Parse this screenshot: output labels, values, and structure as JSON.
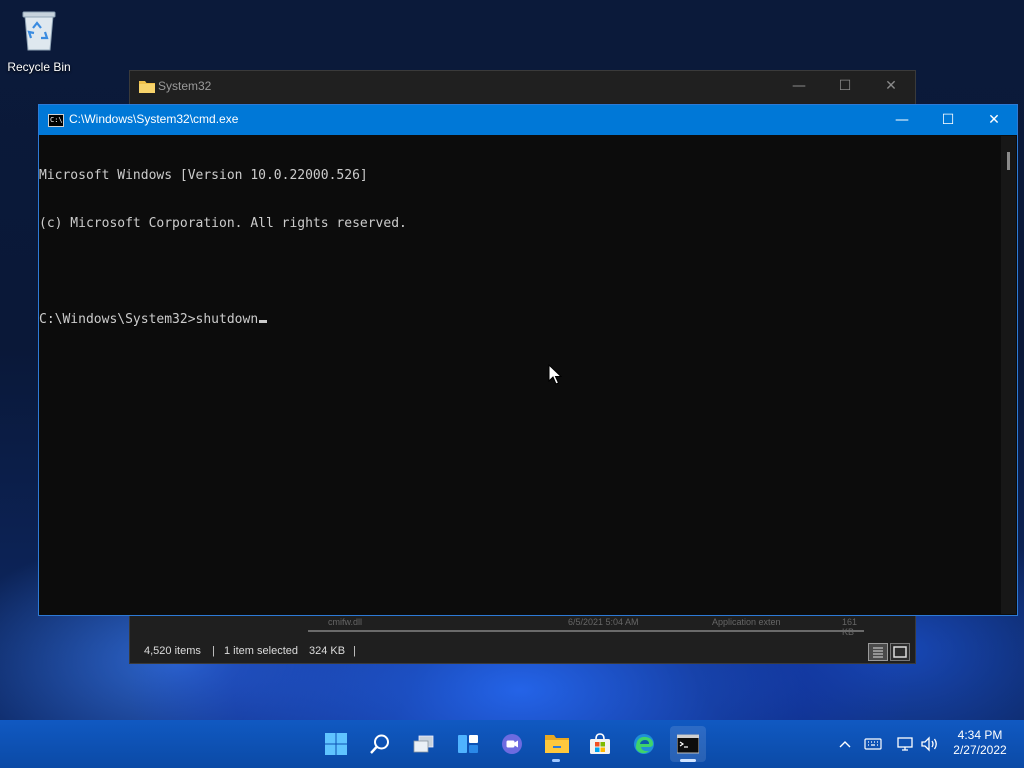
{
  "desktop": {
    "icons": [
      {
        "label": "Recycle Bin",
        "icon": "recycle-bin-icon"
      }
    ]
  },
  "explorer": {
    "title": "System32",
    "status": {
      "items_count": "4,520 items",
      "selected": "1 item selected",
      "size": "324 KB",
      "separator": "|"
    },
    "ghost_row": {
      "name": "cmifw.dll",
      "date": "6/5/2021 5:04 AM",
      "type": "Application exten",
      "size": "161 KB"
    }
  },
  "cmd": {
    "title": "C:\\Windows\\System32\\cmd.exe",
    "icon_glyph": "C:\\",
    "lines": [
      "Microsoft Windows [Version 10.0.22000.526]",
      "(c) Microsoft Corporation. All rights reserved.",
      "",
      "C:\\Windows\\System32>shutdown"
    ]
  },
  "window_controls": {
    "minimize": "—",
    "maximize": "☐",
    "close": "✕"
  },
  "taskbar": {
    "items": [
      {
        "name": "start-button",
        "icon": "windows-logo-icon"
      },
      {
        "name": "search-button",
        "icon": "search-icon"
      },
      {
        "name": "task-view-button",
        "icon": "task-view-icon"
      },
      {
        "name": "widgets-button",
        "icon": "widgets-icon"
      },
      {
        "name": "chat-button",
        "icon": "chat-icon"
      },
      {
        "name": "file-explorer-button",
        "icon": "folder-icon"
      },
      {
        "name": "store-button",
        "icon": "store-icon"
      },
      {
        "name": "edge-button",
        "icon": "edge-icon"
      },
      {
        "name": "cmd-button",
        "icon": "terminal-icon"
      }
    ],
    "clock": {
      "time": "4:34 PM",
      "date": "2/27/2022"
    },
    "colors": {
      "taskbar": "#0b4aa6",
      "accent": "#0078d7"
    }
  }
}
